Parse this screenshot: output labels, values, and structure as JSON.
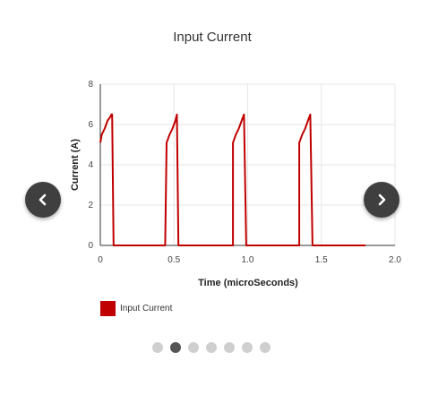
{
  "chart_data": {
    "type": "line",
    "title": "Input Current",
    "xlabel": "Time (microSeconds)",
    "ylabel": "Current (A)",
    "xlim": [
      0,
      2.0
    ],
    "ylim": [
      0,
      8
    ],
    "xticks": [
      0,
      0.5,
      1.0,
      1.5,
      2.0
    ],
    "xtick_labels": [
      "0",
      "0.5",
      "1.0",
      "1.5",
      "2.0"
    ],
    "yticks": [
      0,
      2,
      4,
      6,
      8
    ],
    "ytick_labels": [
      "0",
      "2",
      "4",
      "6",
      "8"
    ],
    "grid": true,
    "legend_position": "bottom-left",
    "series": [
      {
        "name": "Input Current",
        "color": "#c00000",
        "x": [
          0.0,
          0.01,
          0.03,
          0.05,
          0.07,
          0.075,
          0.08,
          0.09,
          0.44,
          0.45,
          0.47,
          0.49,
          0.51,
          0.52,
          0.53,
          0.9,
          0.9,
          0.92,
          0.94,
          0.96,
          0.975,
          0.99,
          1.35,
          1.35,
          1.37,
          1.39,
          1.41,
          1.425,
          1.44,
          1.8
        ],
        "y": [
          5.1,
          5.5,
          5.8,
          6.2,
          6.4,
          6.5,
          6.5,
          0,
          0,
          5.1,
          5.5,
          5.8,
          6.2,
          6.5,
          0,
          0,
          5.1,
          5.5,
          5.8,
          6.2,
          6.5,
          0,
          0,
          5.1,
          5.5,
          5.8,
          6.2,
          6.5,
          0,
          0
        ]
      }
    ]
  },
  "legend": {
    "label": "Input Current",
    "color": "#c00000"
  },
  "carousel": {
    "slide_count": 7,
    "active_index": 1
  },
  "icons": {
    "prev": "chevron-left-icon",
    "next": "chevron-right-icon"
  }
}
